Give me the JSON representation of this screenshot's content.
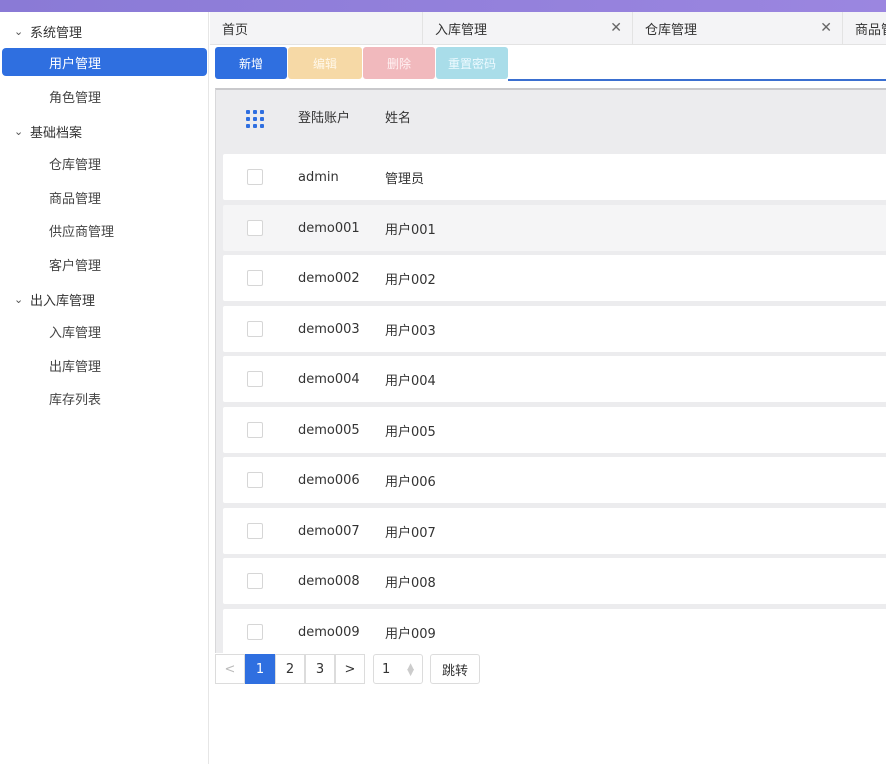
{
  "sidebar": {
    "groups": [
      {
        "title": "系统管理",
        "items": [
          {
            "label": "用户管理",
            "active": true
          },
          {
            "label": "角色管理"
          }
        ]
      },
      {
        "title": "基础档案",
        "items": [
          {
            "label": "仓库管理"
          },
          {
            "label": "商品管理"
          },
          {
            "label": "供应商管理"
          },
          {
            "label": "客户管理"
          }
        ]
      },
      {
        "title": "出入库管理",
        "items": [
          {
            "label": "入库管理"
          },
          {
            "label": "出库管理"
          },
          {
            "label": "库存列表"
          }
        ]
      }
    ]
  },
  "tabs": [
    {
      "label": "首页",
      "closable": false
    },
    {
      "label": "入库管理",
      "closable": true
    },
    {
      "label": "仓库管理",
      "closable": true
    },
    {
      "label": "商品管",
      "closable": false
    }
  ],
  "toolbar": {
    "new_label": "新增",
    "edit_label": "编辑",
    "delete_label": "删除",
    "reset_label": "重置密码"
  },
  "table": {
    "columns": [
      "登陆账户",
      "姓名"
    ],
    "rows": [
      [
        "admin",
        "管理员"
      ],
      [
        "demo001",
        "用户001"
      ],
      [
        "demo002",
        "用户002"
      ],
      [
        "demo003",
        "用户003"
      ],
      [
        "demo004",
        "用户004"
      ],
      [
        "demo005",
        "用户005"
      ],
      [
        "demo006",
        "用户006"
      ],
      [
        "demo007",
        "用户007"
      ],
      [
        "demo008",
        "用户008"
      ],
      [
        "demo009",
        "用户009"
      ]
    ]
  },
  "pager": {
    "prev": "<",
    "pages": [
      "1",
      "2",
      "3"
    ],
    "current_page": "1",
    "next": ">",
    "jump_value": "1",
    "jump_label": "跳转"
  },
  "colors": {
    "accent": "#2f6fe0",
    "topbar": "#9b86e0",
    "edit": "#f6d9a6",
    "delete": "#f1b9bd",
    "reset": "#a9dde9"
  },
  "icons": {
    "group_expand": "chevron-down-icon",
    "tab_close": "close-icon",
    "column_settings": "grid-dots-icon"
  }
}
